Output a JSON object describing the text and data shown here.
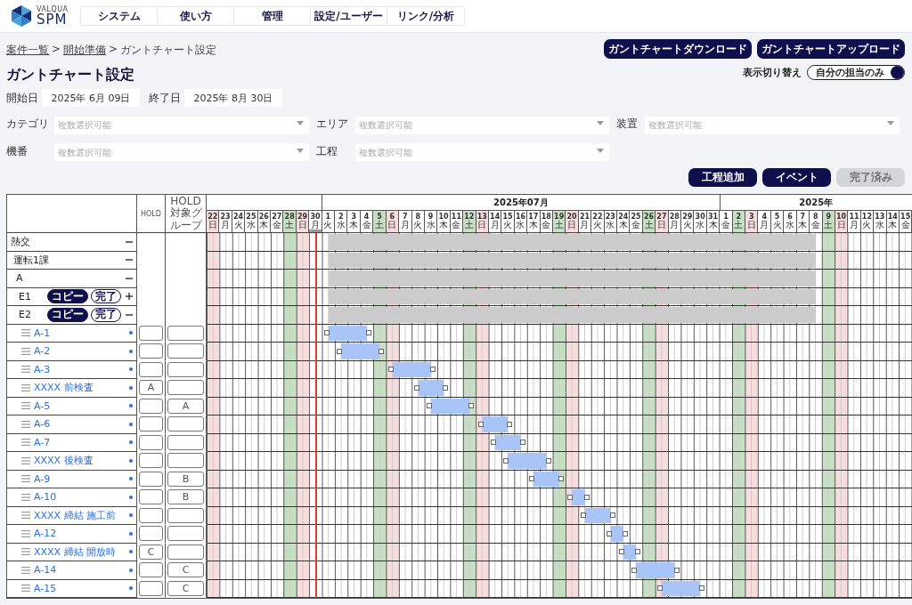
{
  "logo": {
    "small": "VALQUA",
    "large": "SPM"
  },
  "nav": [
    "システム",
    "使い方",
    "管理",
    "設定/ユーザー",
    "リンク/分析"
  ],
  "breadcrumb": [
    {
      "label": "案件一覧",
      "link": true
    },
    {
      "label": ">",
      "link": false
    },
    {
      "label": "開始準備",
      "link": true
    },
    {
      "label": ">",
      "link": false
    },
    {
      "label": "ガントチャート設定",
      "link": false
    }
  ],
  "title": "ガントチャート設定",
  "top_buttons": [
    "ガントチャートダウンロード",
    "ガントチャートアップロード"
  ],
  "toggle": {
    "label": "表示切り替え",
    "text": "自分の担当のみ",
    "on": true
  },
  "dates": [
    {
      "label": "開始日",
      "value": "2025年 6月 09日"
    },
    {
      "label": "終了日",
      "value": "2025年 8月 30日"
    }
  ],
  "filters": [
    {
      "label": "カテゴリ",
      "placeholder": "複数選択可能"
    },
    {
      "label": "エリア",
      "placeholder": "複数選択可能"
    },
    {
      "label": "装置",
      "placeholder": "複数選択可能"
    },
    {
      "label": "機番",
      "placeholder": "複数選択可能"
    },
    {
      "label": "工程",
      "placeholder": "複数選択可能"
    }
  ],
  "actions": [
    {
      "label": "工程追加",
      "disabled": false
    },
    {
      "label": "イベント",
      "disabled": false
    },
    {
      "label": "完了済み",
      "disabled": true
    }
  ],
  "gantt": {
    "columns": [
      "HOLD",
      "HOLD\n対象グループ"
    ],
    "timeline": {
      "months": [
        {
          "days": [
            {
              "day": "22",
              "weekday": "日",
              "kind": "sun",
              "today": false
            },
            {
              "day": "23",
              "weekday": "月",
              "kind": "weekday",
              "today": false
            },
            {
              "day": "24",
              "weekday": "火",
              "kind": "weekday",
              "today": false
            },
            {
              "day": "25",
              "weekday": "水",
              "kind": "weekday",
              "today": false
            },
            {
              "day": "26",
              "weekday": "木",
              "kind": "weekday",
              "today": false
            },
            {
              "day": "27",
              "weekday": "金",
              "kind": "weekday",
              "today": false
            },
            {
              "day": "28",
              "weekday": "土",
              "kind": "sat",
              "today": false
            },
            {
              "day": "29",
              "weekday": "日",
              "kind": "sun",
              "today": false
            },
            {
              "day": "30",
              "weekday": "月",
              "kind": "weekday",
              "today": true
            }
          ]
        },
        {
          "label": "2025年07月",
          "days": [
            {
              "day": "1",
              "weekday": "火",
              "kind": "weekday",
              "today": false
            },
            {
              "day": "2",
              "weekday": "水",
              "kind": "weekday",
              "today": false
            },
            {
              "day": "3",
              "weekday": "木",
              "kind": "weekday",
              "today": false
            },
            {
              "day": "4",
              "weekday": "金",
              "kind": "weekday",
              "today": false
            },
            {
              "day": "5",
              "weekday": "土",
              "kind": "sat",
              "today": false
            },
            {
              "day": "6",
              "weekday": "日",
              "kind": "sun",
              "today": false
            },
            {
              "day": "7",
              "weekday": "月",
              "kind": "weekday",
              "today": false
            },
            {
              "day": "8",
              "weekday": "火",
              "kind": "weekday",
              "today": false
            },
            {
              "day": "9",
              "weekday": "水",
              "kind": "weekday",
              "today": false
            },
            {
              "day": "10",
              "weekday": "木",
              "kind": "weekday",
              "today": false
            },
            {
              "day": "11",
              "weekday": "金",
              "kind": "weekday",
              "today": false
            },
            {
              "day": "12",
              "weekday": "土",
              "kind": "sat",
              "today": false
            },
            {
              "day": "13",
              "weekday": "日",
              "kind": "sun",
              "today": false
            },
            {
              "day": "14",
              "weekday": "月",
              "kind": "weekday",
              "today": false
            },
            {
              "day": "15",
              "weekday": "火",
              "kind": "weekday",
              "today": false
            },
            {
              "day": "16",
              "weekday": "水",
              "kind": "weekday",
              "today": false
            },
            {
              "day": "17",
              "weekday": "木",
              "kind": "weekday",
              "today": false
            },
            {
              "day": "18",
              "weekday": "金",
              "kind": "weekday",
              "today": false
            },
            {
              "day": "19",
              "weekday": "土",
              "kind": "sat",
              "today": false
            },
            {
              "day": "20",
              "weekday": "日",
              "kind": "sun",
              "today": false
            },
            {
              "day": "21",
              "weekday": "月",
              "kind": "weekday",
              "today": false
            },
            {
              "day": "22",
              "weekday": "火",
              "kind": "weekday",
              "today": false
            },
            {
              "day": "23",
              "weekday": "水",
              "kind": "weekday",
              "today": false
            },
            {
              "day": "24",
              "weekday": "木",
              "kind": "weekday",
              "today": false
            },
            {
              "day": "25",
              "weekday": "金",
              "kind": "weekday",
              "today": false
            },
            {
              "day": "26",
              "weekday": "土",
              "kind": "sat",
              "today": false
            },
            {
              "day": "27",
              "weekday": "日",
              "kind": "sun",
              "today": false
            },
            {
              "day": "28",
              "weekday": "月",
              "kind": "weekday",
              "today": false
            },
            {
              "day": "29",
              "weekday": "火",
              "kind": "weekday",
              "today": false
            },
            {
              "day": "30",
              "weekday": "水",
              "kind": "weekday",
              "today": false
            },
            {
              "day": "31",
              "weekday": "木",
              "kind": "weekday",
              "today": false
            }
          ]
        },
        {
          "label": "2025年",
          "days": [
            {
              "day": "1",
              "weekday": "金",
              "kind": "weekday",
              "today": false
            },
            {
              "day": "2",
              "weekday": "土",
              "kind": "sat",
              "today": false
            },
            {
              "day": "3",
              "weekday": "日",
              "kind": "sun",
              "today": false
            },
            {
              "day": "4",
              "weekday": "月",
              "kind": "weekday",
              "today": false
            },
            {
              "day": "5",
              "weekday": "火",
              "kind": "weekday",
              "today": false
            },
            {
              "day": "6",
              "weekday": "水",
              "kind": "weekday",
              "today": false
            },
            {
              "day": "7",
              "weekday": "木",
              "kind": "weekday",
              "today": false
            },
            {
              "day": "8",
              "weekday": "金",
              "kind": "weekday",
              "today": false
            },
            {
              "day": "9",
              "weekday": "土",
              "kind": "sat",
              "today": false
            },
            {
              "day": "10",
              "weekday": "日",
              "kind": "sun",
              "today": false
            },
            {
              "day": "11",
              "weekday": "月",
              "kind": "weekday",
              "today": false
            },
            {
              "day": "12",
              "weekday": "火",
              "kind": "weekday",
              "today": false
            },
            {
              "day": "13",
              "weekday": "水",
              "kind": "weekday",
              "today": false
            },
            {
              "day": "14",
              "weekday": "木",
              "kind": "weekday",
              "today": false
            },
            {
              "day": "15",
              "weekday": "金",
              "kind": "weekday",
              "today": false
            }
          ]
        }
      ]
    },
    "rows": [
      {
        "label": "熱交",
        "kind": "group",
        "expanded": true,
        "children": [
          {
            "label": "運転1課",
            "kind": "group",
            "expanded": true,
            "children": [
              {
                "label": "A",
                "kind": "group",
                "expanded": true,
                "children": [
                  {
                    "label": "E1",
                    "kind": "group",
                    "expanded": false,
                    "actions": [
                      {
                        "label": "コピー",
                        "kind": "filled"
                      },
                      {
                        "label": "完了",
                        "kind": "outline"
                      }
                    ]
                  },
                  {
                    "label": "E2",
                    "kind": "group",
                    "expanded": true,
                    "actions": [
                      {
                        "label": "コピー",
                        "kind": "filled"
                      },
                      {
                        "label": "完了",
                        "kind": "outline"
                      }
                    ],
                    "children": [
                      {
                        "label": "A-1",
                        "kind": "task"
                      },
                      {
                        "label": "A-2",
                        "kind": "task"
                      },
                      {
                        "label": "A-3",
                        "kind": "task"
                      },
                      {
                        "label": "XXXX 前検査",
                        "kind": "task",
                        "hold": "A"
                      },
                      {
                        "label": "A-5",
                        "kind": "task",
                        "hold_group": "A"
                      },
                      {
                        "label": "A-6",
                        "kind": "task"
                      },
                      {
                        "label": "A-7",
                        "kind": "task"
                      },
                      {
                        "label": "XXXX 後検査",
                        "kind": "task"
                      },
                      {
                        "label": "A-9",
                        "kind": "task",
                        "hold_group": "B"
                      },
                      {
                        "label": "A-10",
                        "kind": "task",
                        "hold_group": "B"
                      },
                      {
                        "label": "XXXX 締結 施工前",
                        "kind": "task"
                      },
                      {
                        "label": "A-12",
                        "kind": "task"
                      },
                      {
                        "label": "XXXX 締結 開放時",
                        "kind": "task",
                        "hold": "C"
                      },
                      {
                        "label": "A-14",
                        "kind": "task",
                        "hold_group": "C"
                      },
                      {
                        "label": "A-15",
                        "kind": "task",
                        "hold_group": "C"
                      }
                    ]
                  }
                ]
              }
            ]
          }
        ]
      }
    ]
  }
}
